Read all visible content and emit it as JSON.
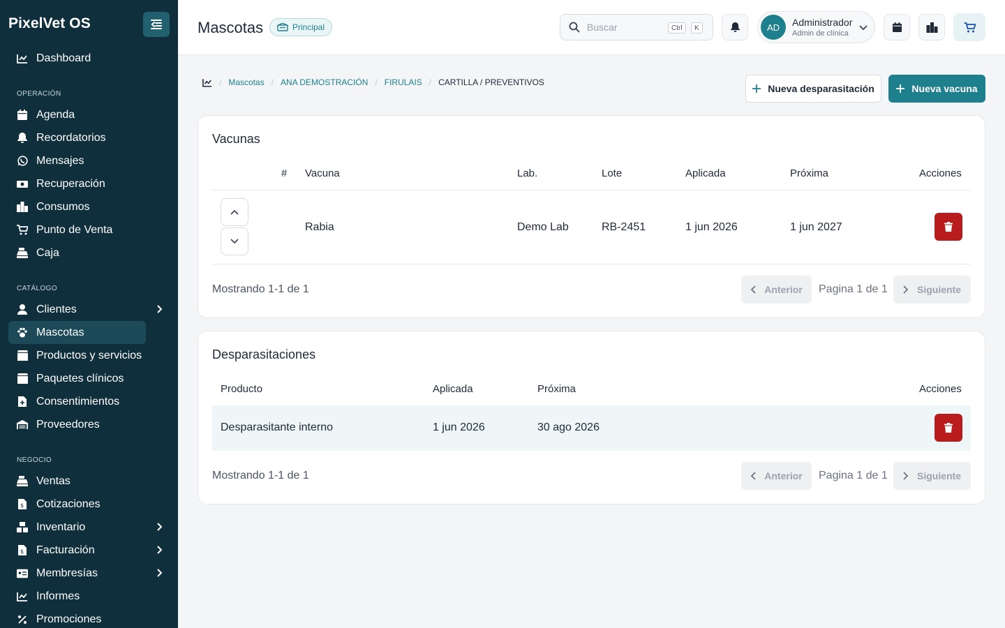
{
  "app": {
    "brand": "PixelVet OS"
  },
  "sidebar": {
    "top": [
      {
        "label": "Dashboard",
        "icon": "chart-line-icon"
      }
    ],
    "sections": [
      {
        "label": "OPERACIÓN",
        "items": [
          {
            "label": "Agenda",
            "icon": "calendar-icon"
          },
          {
            "label": "Recordatorios",
            "icon": "bell-icon"
          },
          {
            "label": "Mensajes",
            "icon": "whatsapp-icon"
          },
          {
            "label": "Recuperación",
            "icon": "money-icon"
          },
          {
            "label": "Consumos",
            "icon": "building-icon"
          },
          {
            "label": "Punto de Venta",
            "icon": "cart-icon"
          },
          {
            "label": "Caja",
            "icon": "cash-register-icon"
          }
        ]
      },
      {
        "label": "CATÁLOGO",
        "items": [
          {
            "label": "Clientes",
            "icon": "user-icon",
            "expandable": true
          },
          {
            "label": "Mascotas",
            "icon": "paw-icon",
            "active": true
          },
          {
            "label": "Productos y servicios",
            "icon": "box-icon"
          },
          {
            "label": "Paquetes clínicos",
            "icon": "box-icon"
          },
          {
            "label": "Consentimientos",
            "icon": "file-plus-icon"
          },
          {
            "label": "Proveedores",
            "icon": "warehouse-icon"
          }
        ]
      },
      {
        "label": "NEGOCIO",
        "items": [
          {
            "label": "Ventas",
            "icon": "cash-register-icon"
          },
          {
            "label": "Cotizaciones",
            "icon": "file-dollar-icon"
          },
          {
            "label": "Inventario",
            "icon": "boxes-icon",
            "expandable": true
          },
          {
            "label": "Facturación",
            "icon": "invoice-icon",
            "expandable": true
          },
          {
            "label": "Membresías",
            "icon": "id-card-icon",
            "expandable": true
          },
          {
            "label": "Informes",
            "icon": "chart-line-icon"
          },
          {
            "label": "Promociones",
            "icon": "percent-icon"
          }
        ]
      }
    ]
  },
  "header": {
    "title": "Mascotas",
    "branch": "Principal",
    "search_placeholder": "Buscar",
    "kbd_ctrl": "Ctrl",
    "kbd_k": "K",
    "user_initials": "AD",
    "user_name": "Administrador",
    "user_role": "Admin de clínica"
  },
  "breadcrumb": {
    "items": [
      "Mascotas",
      "ANA DEMOSTRACIÓN",
      "FIRULAIS"
    ],
    "current": "CARTILLA / PREVENTIVOS"
  },
  "actions": {
    "new_deworming": "Nueva desparasitación",
    "new_vaccine": "Nueva vacuna"
  },
  "vaccines": {
    "title": "Vacunas",
    "columns": [
      "#",
      "Vacuna",
      "Lab.",
      "Lote",
      "Aplicada",
      "Próxima",
      "Acciones"
    ],
    "rows": [
      {
        "name": "Rabia",
        "lab": "Demo Lab",
        "lot": "RB-2451",
        "applied": "1 jun 2026",
        "next": "1 jun 2027"
      }
    ],
    "showing": "Mostrando 1-1 de 1",
    "prev": "Anterior",
    "page": "Pagina 1 de 1",
    "next": "Siguiente"
  },
  "deworming": {
    "title": "Desparasitaciones",
    "columns": [
      "Producto",
      "Aplicada",
      "Próxima",
      "Acciones"
    ],
    "rows": [
      {
        "product": "Desparasitante interno",
        "applied": "1 jun 2026",
        "next": "30 ago 2026"
      }
    ],
    "showing": "Mostrando 1-1 de 1",
    "prev": "Anterior",
    "page": "Pagina 1 de 1",
    "next": "Siguiente"
  },
  "colors": {
    "sidebar": "#0f2f3d",
    "accent": "#1e7f8d",
    "danger": "#b91c1c"
  }
}
